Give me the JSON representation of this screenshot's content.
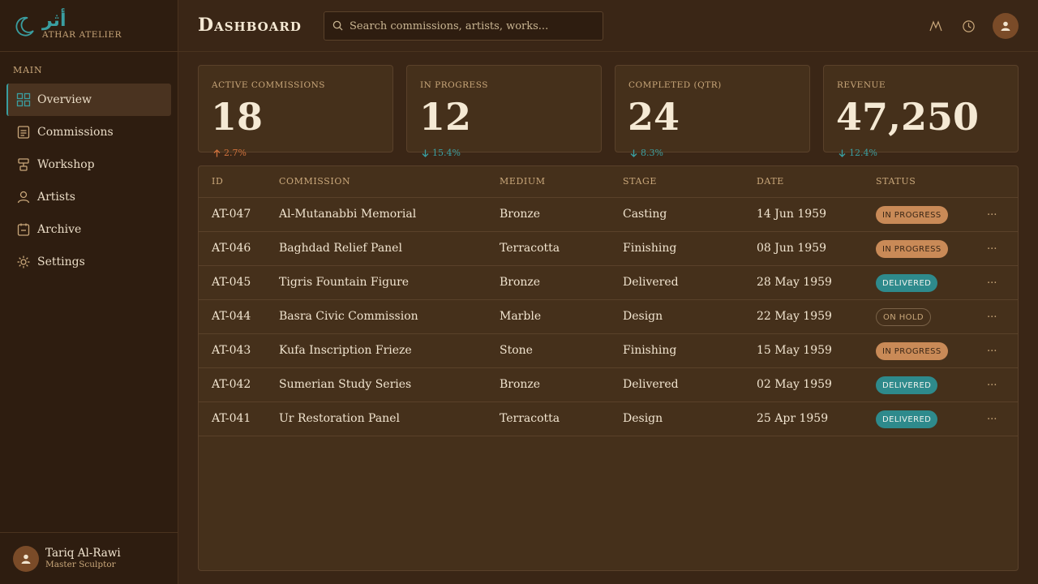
{
  "brand": {
    "arabic": "أثر",
    "name": "ATHAR ATELIER"
  },
  "sidebar": {
    "section": "MAIN",
    "items": [
      {
        "label": "Overview",
        "icon": "grid-icon",
        "active": true
      },
      {
        "label": "Commissions",
        "icon": "document-icon"
      },
      {
        "label": "Workshop",
        "icon": "workbench-icon"
      },
      {
        "label": "Artists",
        "icon": "person-icon"
      },
      {
        "label": "Archive",
        "icon": "archive-box-icon"
      },
      {
        "label": "Settings",
        "icon": "gear-icon"
      }
    ],
    "user": {
      "name": "Tariq Al-Rawi",
      "role": "Master Sculptor"
    }
  },
  "header": {
    "title": "Dashboard",
    "search_placeholder": "Search commissions, artists, works..."
  },
  "stats": [
    {
      "label": "ACTIVE COMMISSIONS",
      "value": "18",
      "trend": "2.7%",
      "direction": "up"
    },
    {
      "label": "IN PROGRESS",
      "value": "12",
      "trend": "15.4%",
      "direction": "down"
    },
    {
      "label": "COMPLETED (QTR)",
      "value": "24",
      "trend": "8.3%",
      "direction": "down"
    },
    {
      "label": "REVENUE",
      "value": "47,250",
      "trend": "12.4%",
      "direction": "down"
    }
  ],
  "table": {
    "columns": [
      "ID",
      "COMMISSION",
      "MEDIUM",
      "STAGE",
      "DATE",
      "STATUS"
    ],
    "rows": [
      {
        "id": "AT-047",
        "commission": "Al-Mutanabbi Memorial",
        "medium": "Bronze",
        "stage": "Casting",
        "date": "14 Jun 1959",
        "status": "IN PROGRESS",
        "status_type": "progress"
      },
      {
        "id": "AT-046",
        "commission": "Baghdad Relief Panel",
        "medium": "Terracotta",
        "stage": "Finishing",
        "date": "08 Jun 1959",
        "status": "IN PROGRESS",
        "status_type": "progress"
      },
      {
        "id": "AT-045",
        "commission": "Tigris Fountain Figure",
        "medium": "Bronze",
        "stage": "Delivered",
        "date": "28 May 1959",
        "status": "DELIVERED",
        "status_type": "delivered"
      },
      {
        "id": "AT-044",
        "commission": "Basra Civic Commission",
        "medium": "Marble",
        "stage": "Design",
        "date": "22 May 1959",
        "status": "ON HOLD",
        "status_type": "hold"
      },
      {
        "id": "AT-043",
        "commission": "Kufa Inscription Frieze",
        "medium": "Stone",
        "stage": "Finishing",
        "date": "15 May 1959",
        "status": "IN PROGRESS",
        "status_type": "progress"
      },
      {
        "id": "AT-042",
        "commission": "Sumerian Study Series",
        "medium": "Bronze",
        "stage": "Delivered",
        "date": "02 May 1959",
        "status": "DELIVERED",
        "status_type": "delivered"
      },
      {
        "id": "AT-041",
        "commission": "Ur Restoration Panel",
        "medium": "Terracotta",
        "stage": "Design",
        "date": "25 Apr 1959",
        "status": "DELIVERED",
        "status_type": "delivered"
      }
    ],
    "row_action": "..."
  },
  "colors": {
    "accent": "#3a9ea0",
    "progress": "#c98a57",
    "up": "#d0713c"
  }
}
